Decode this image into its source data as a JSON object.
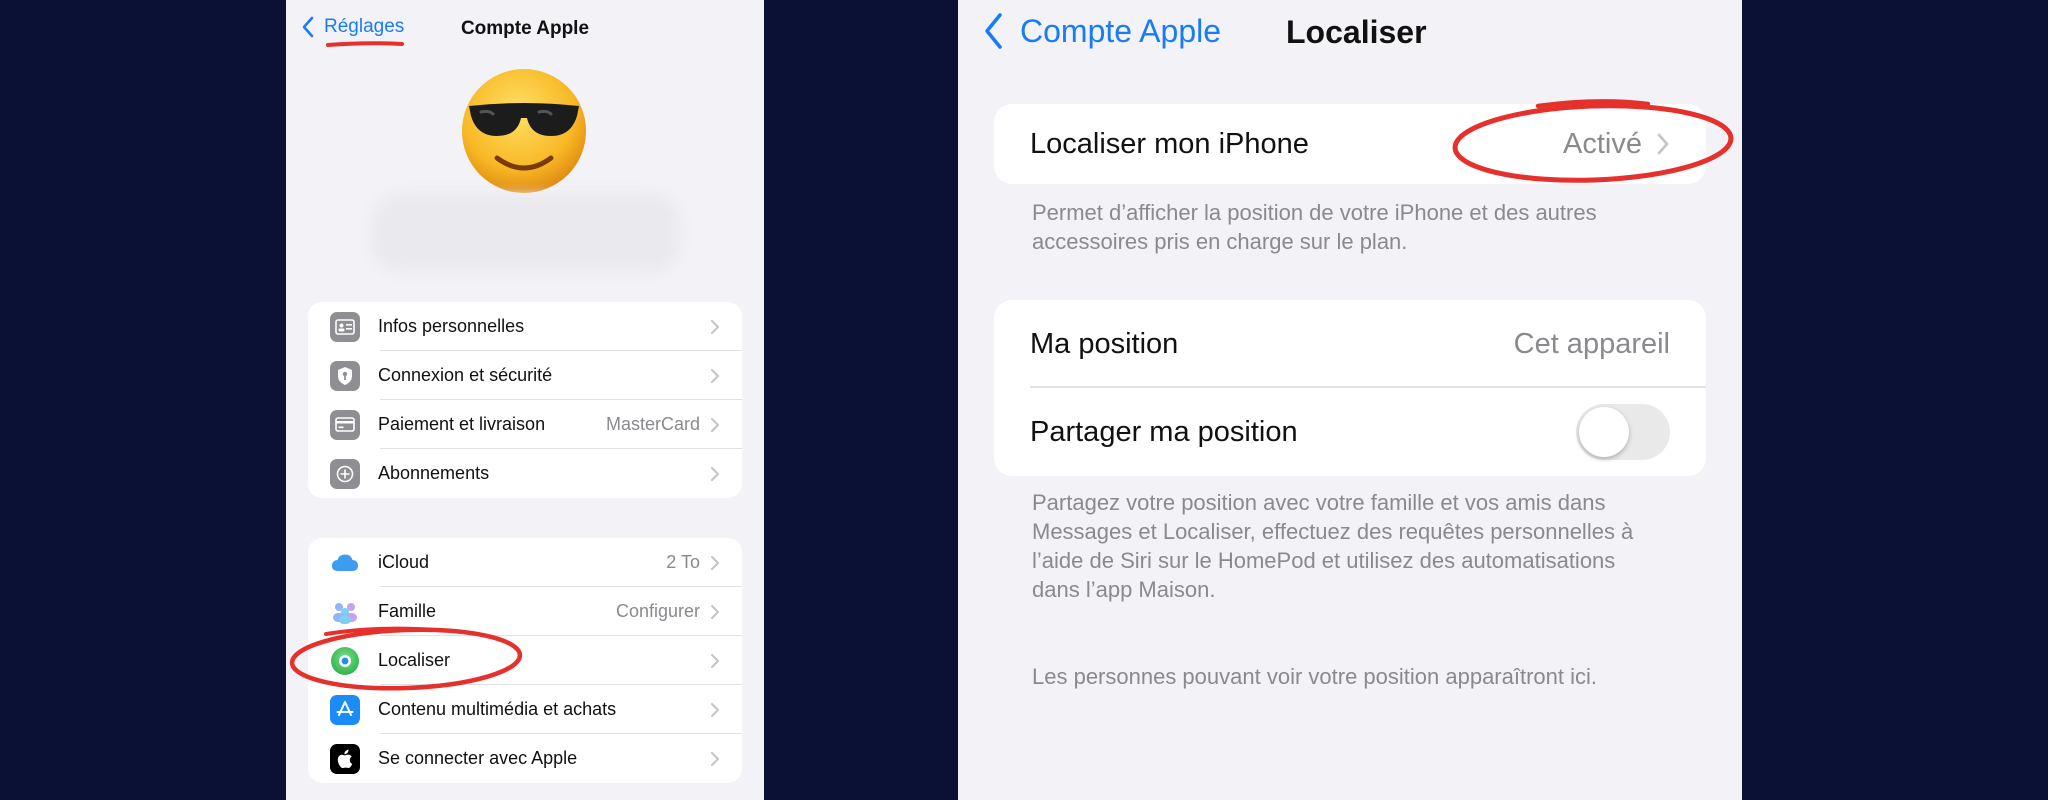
{
  "left_screen": {
    "back_label": "Réglages",
    "title": "Compte Apple",
    "groups": [
      {
        "rows": [
          {
            "label": "Infos personnelles",
            "value": "",
            "icon": "id-card-icon"
          },
          {
            "label": "Connexion et sécurité",
            "value": "",
            "icon": "key-shield-icon"
          },
          {
            "label": "Paiement et livraison",
            "value": "MasterCard",
            "icon": "credit-card-icon"
          },
          {
            "label": "Abonnements",
            "value": "",
            "icon": "subscriptions-icon"
          }
        ]
      },
      {
        "rows": [
          {
            "label": "iCloud",
            "value": "2 To",
            "icon": "icloud-icon"
          },
          {
            "label": "Famille",
            "value": "Configurer",
            "icon": "family-icon"
          },
          {
            "label": "Localiser",
            "value": "",
            "icon": "find-my-icon"
          },
          {
            "label": "Contenu multimédia et achats",
            "value": "",
            "icon": "app-store-icon"
          },
          {
            "label": "Se connecter avec Apple",
            "value": "",
            "icon": "apple-logo-icon"
          }
        ]
      }
    ]
  },
  "right_screen": {
    "back_label": "Compte Apple",
    "title": "Localiser",
    "find_my_iphone": {
      "label": "Localiser mon iPhone",
      "value": "Activé"
    },
    "find_my_footnote": "Permet d’afficher la position de votre iPhone et des autres accessoires pris en charge sur le plan.",
    "my_location": {
      "label": "Ma position",
      "value": "Cet appareil"
    },
    "share_location": {
      "label": "Partager ma position",
      "toggle_on": false
    },
    "share_footnote": "Partagez votre position avec votre famille et vos amis dans Messages et Localiser, effectuez des requêtes personnelles à l’aide de Siri sur le HomePod et utilisez des automatisations dans l’app Maison.",
    "people_footnote": "Les personnes pouvant voir votre position apparaîtront ici."
  },
  "colors": {
    "background": "#0b1035",
    "screen_bg": "#f2f2f7",
    "ios_blue": "#1a7cf5",
    "annotation_red": "#e5302b"
  }
}
